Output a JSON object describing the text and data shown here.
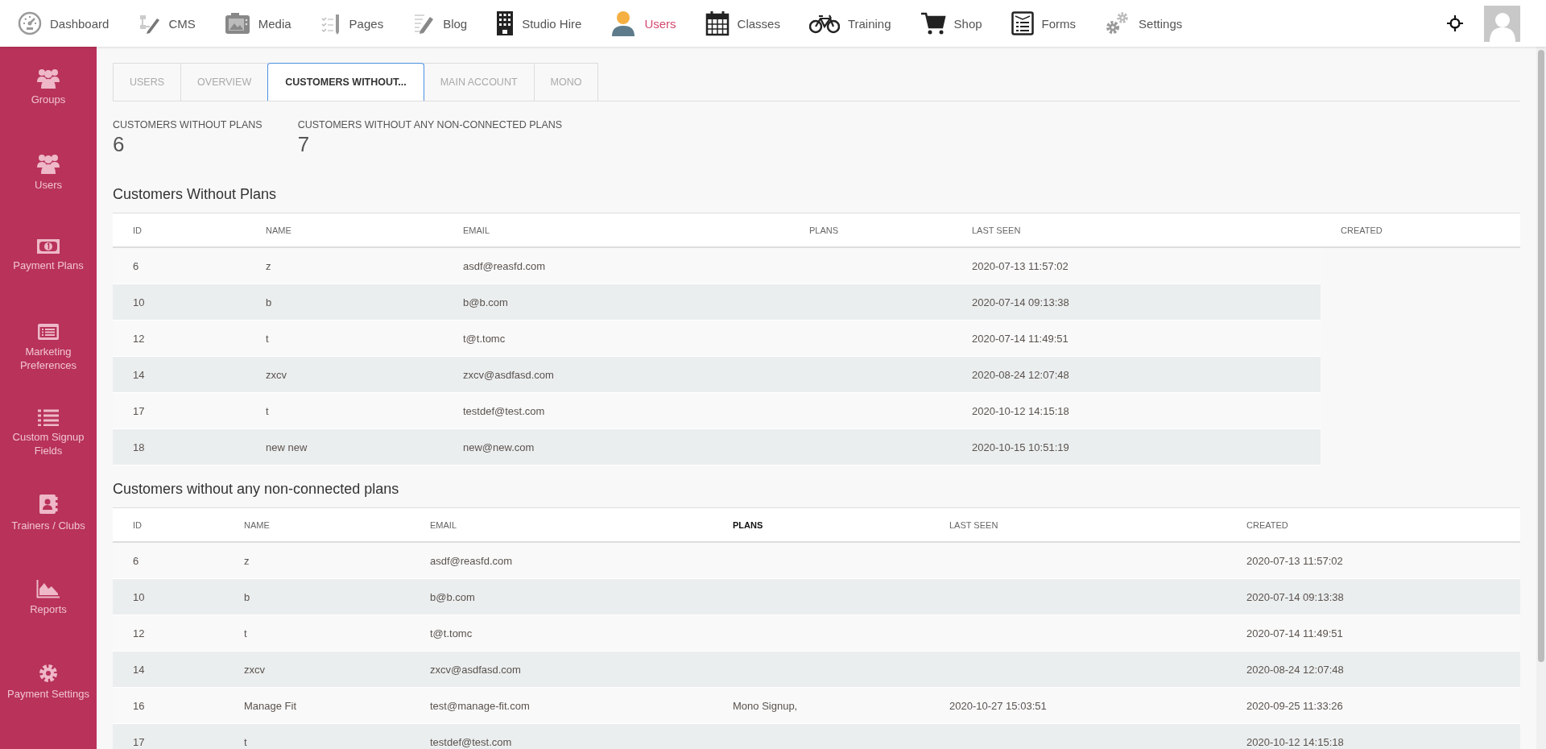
{
  "nav": [
    {
      "label": "Dashboard",
      "selected": false
    },
    {
      "label": "CMS",
      "selected": false
    },
    {
      "label": "Media",
      "selected": false
    },
    {
      "label": "Pages",
      "selected": false
    },
    {
      "label": "Blog",
      "selected": false
    },
    {
      "label": "Studio Hire",
      "selected": false
    },
    {
      "label": "Users",
      "selected": true
    },
    {
      "label": "Classes",
      "selected": false
    },
    {
      "label": "Training",
      "selected": false
    },
    {
      "label": "Shop",
      "selected": false
    },
    {
      "label": "Forms",
      "selected": false
    },
    {
      "label": "Settings",
      "selected": false
    }
  ],
  "sidebar": {
    "items": [
      {
        "label": "Groups"
      },
      {
        "label": "Users"
      },
      {
        "label": "Payment Plans"
      },
      {
        "label": "Marketing Preferences"
      },
      {
        "label": "Custom Signup Fields"
      },
      {
        "label": "Trainers / Clubs"
      },
      {
        "label": "Reports"
      },
      {
        "label": "Payment Settings"
      }
    ]
  },
  "tabs": [
    {
      "label": "USERS",
      "selected": false
    },
    {
      "label": "OVERVIEW",
      "selected": false
    },
    {
      "label": "CUSTOMERS WITHOUT...",
      "selected": true
    },
    {
      "label": "MAIN ACCOUNT",
      "selected": false
    },
    {
      "label": "MONO",
      "selected": false
    }
  ],
  "stats": [
    {
      "label": "CUSTOMERS WITHOUT PLANS",
      "value": "6"
    },
    {
      "label": "CUSTOMERS WITHOUT ANY NON-CONNECTED PLANS",
      "value": "7"
    }
  ],
  "tables": [
    {
      "title": "Customers Without Plans",
      "columns": [
        {
          "label": "ID",
          "sorted": false
        },
        {
          "label": "NAME",
          "sorted": false
        },
        {
          "label": "EMAIL",
          "sorted": false
        },
        {
          "label": "PLANS",
          "sorted": false
        },
        {
          "label": "LAST SEEN",
          "sorted": false
        },
        {
          "label": "CREATED",
          "sorted": false
        }
      ],
      "rows": [
        [
          "6",
          "z",
          "asdf@reasfd.com",
          null,
          "2020-07-13 11:57:02"
        ],
        [
          "10",
          "b",
          "b@b.com",
          null,
          "2020-07-14 09:13:38"
        ],
        [
          "12",
          "t",
          "t@t.tomc",
          null,
          "2020-07-14 11:49:51"
        ],
        [
          "14",
          "zxcv",
          "zxcv@asdfasd.com",
          null,
          "2020-08-24 12:07:48"
        ],
        [
          "17",
          "t",
          "testdef@test.com",
          null,
          "2020-10-12 14:15:18"
        ],
        [
          "18",
          "new new",
          "new@new.com",
          null,
          "2020-10-15 10:51:19"
        ]
      ]
    },
    {
      "title": "Customers without any non-connected plans",
      "columns": [
        {
          "label": "ID",
          "sorted": false
        },
        {
          "label": "NAME",
          "sorted": false
        },
        {
          "label": "EMAIL",
          "sorted": false
        },
        {
          "label": "PLANS",
          "sorted": true
        },
        {
          "label": "LAST SEEN",
          "sorted": false
        },
        {
          "label": "CREATED",
          "sorted": false
        }
      ],
      "rows": [
        [
          "6",
          "z",
          "asdf@reasfd.com",
          null,
          null,
          "2020-07-13 11:57:02"
        ],
        [
          "10",
          "b",
          "b@b.com",
          null,
          null,
          "2020-07-14 09:13:38"
        ],
        [
          "12",
          "t",
          "t@t.tomc",
          null,
          null,
          "2020-07-14 11:49:51"
        ],
        [
          "14",
          "zxcv",
          "zxcv@asdfasd.com",
          null,
          null,
          "2020-08-24 12:07:48"
        ],
        [
          "16",
          "Manage Fit",
          "test@manage-fit.com",
          "Mono Signup,",
          "2020-10-27 15:03:51",
          "2020-09-25 11:33:26"
        ],
        [
          "17",
          "t",
          "testdef@test.com",
          null,
          null,
          "2020-10-12 14:15:18"
        ]
      ]
    }
  ]
}
